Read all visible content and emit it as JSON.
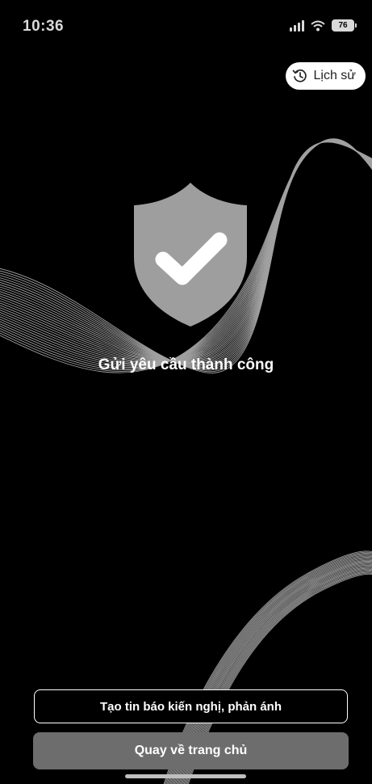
{
  "status_bar": {
    "time": "10:36",
    "battery": "76"
  },
  "header": {
    "history_label": "Lịch sử"
  },
  "result": {
    "title": "Gửi yêu cầu thành công"
  },
  "actions": {
    "create_report_label": "Tạo tin báo kiến nghị, phản ánh",
    "go_home_label": "Quay về trang chủ"
  },
  "colors": {
    "background": "#000000",
    "shield": "#9e9e9e",
    "primary_button": "#6d6d6d",
    "history_pill": "#ffffff"
  },
  "icons": {
    "history": "history-icon",
    "success": "shield-check-icon"
  }
}
